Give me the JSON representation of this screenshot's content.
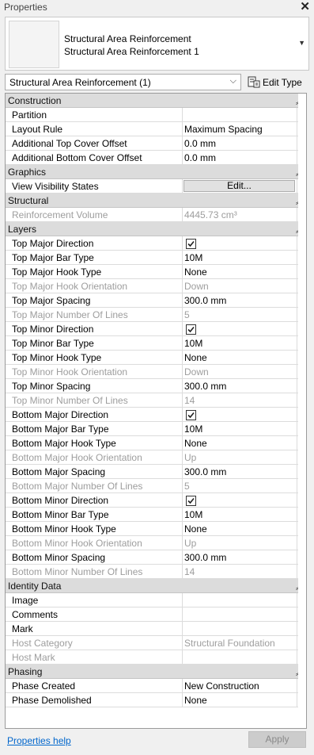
{
  "panel": {
    "title": "Properties"
  },
  "type_selector": {
    "family": "Structural Area Reinforcement",
    "type": "Structural Area Reinforcement 1"
  },
  "instance_filter": {
    "label": "Structural Area Reinforcement (1)"
  },
  "edit_type": {
    "label": "Edit Type"
  },
  "groups": [
    {
      "label": "Construction",
      "rows": [
        {
          "name": "Partition",
          "value": ""
        },
        {
          "name": "Layout Rule",
          "value": "Maximum Spacing"
        },
        {
          "name": "Additional Top Cover Offset",
          "value": "0.0 mm"
        },
        {
          "name": "Additional Bottom Cover Offset",
          "value": "0.0 mm"
        }
      ]
    },
    {
      "label": "Graphics",
      "rows": [
        {
          "name": "View Visibility States",
          "button": "Edit..."
        }
      ]
    },
    {
      "label": "Structural",
      "rows": [
        {
          "name": "Reinforcement Volume",
          "value": "4445.73 cm³",
          "disabled": true
        }
      ]
    },
    {
      "label": "Layers",
      "rows": [
        {
          "name": "Top Major Direction",
          "checked": true
        },
        {
          "name": "Top Major Bar Type",
          "value": "10M"
        },
        {
          "name": "Top Major Hook Type",
          "value": "None"
        },
        {
          "name": "Top Major Hook Orientation",
          "value": "Down",
          "disabled": true
        },
        {
          "name": "Top Major Spacing",
          "value": "300.0 mm"
        },
        {
          "name": "Top Major Number Of Lines",
          "value": "5",
          "disabled": true
        },
        {
          "name": "Top Minor Direction",
          "checked": true
        },
        {
          "name": "Top Minor Bar Type",
          "value": "10M"
        },
        {
          "name": "Top Minor Hook Type",
          "value": "None"
        },
        {
          "name": "Top Minor Hook Orientation",
          "value": "Down",
          "disabled": true
        },
        {
          "name": "Top Minor Spacing",
          "value": "300.0 mm"
        },
        {
          "name": "Top Minor Number Of Lines",
          "value": "14",
          "disabled": true
        },
        {
          "name": "Bottom Major Direction",
          "checked": true
        },
        {
          "name": "Bottom Major Bar Type",
          "value": "10M"
        },
        {
          "name": "Bottom Major Hook Type",
          "value": "None"
        },
        {
          "name": "Bottom Major Hook Orientation",
          "value": "Up",
          "disabled": true
        },
        {
          "name": "Bottom Major Spacing",
          "value": "300.0 mm"
        },
        {
          "name": "Bottom Major Number Of Lines",
          "value": "5",
          "disabled": true
        },
        {
          "name": "Bottom Minor Direction",
          "checked": true
        },
        {
          "name": "Bottom Minor Bar Type",
          "value": "10M"
        },
        {
          "name": "Bottom Minor Hook Type",
          "value": "None"
        },
        {
          "name": "Bottom Minor Hook Orientation",
          "value": "Up",
          "disabled": true
        },
        {
          "name": "Bottom Minor Spacing",
          "value": "300.0 mm"
        },
        {
          "name": "Bottom Minor Number Of Lines",
          "value": "14",
          "disabled": true
        }
      ]
    },
    {
      "label": "Identity Data",
      "rows": [
        {
          "name": "Image",
          "value": ""
        },
        {
          "name": "Comments",
          "value": ""
        },
        {
          "name": "Mark",
          "value": ""
        },
        {
          "name": "Host Category",
          "value": "Structural Foundation",
          "disabled": true
        },
        {
          "name": "Host Mark",
          "value": "",
          "disabled": true
        }
      ]
    },
    {
      "label": "Phasing",
      "rows": [
        {
          "name": "Phase Created",
          "value": "New Construction"
        },
        {
          "name": "Phase Demolished",
          "value": "None"
        }
      ]
    }
  ],
  "footer": {
    "help_label": "Properties help",
    "apply_label": "Apply"
  },
  "icons": {
    "close": "close-icon",
    "collapse": "collapse-chevron-icon",
    "checkbox": "checkbox-checked-icon",
    "dropdown": "chevron-down-icon",
    "edit_type": "edit-type-icon"
  },
  "colors": {
    "group_header": "#dcdcdc",
    "link": "#0066cc",
    "disabled_text": "#9d9d9d"
  }
}
